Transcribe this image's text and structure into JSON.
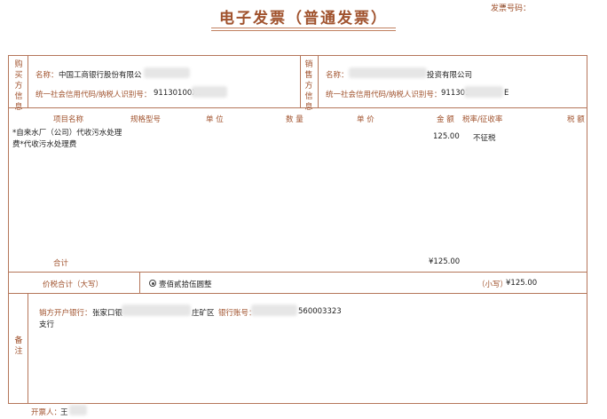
{
  "header": {
    "title": "电子发票（普通发票）",
    "invoice_no_label": "发票号码：",
    "invoice_no_value": "-"
  },
  "buyer": {
    "side_label": "购买方信息",
    "name_label": "名称：",
    "name_value": "中国工商银行股份有限公",
    "tax_label": "统一社会信用代码/纳税人识别号：",
    "tax_value": "91130100X0"
  },
  "seller": {
    "side_label": "销售方信息",
    "name_label": "名称：",
    "name_value": "投资有限公司",
    "tax_label": "统一社会信用代码/纳税人识别号：",
    "tax_value_prefix": "911301",
    "tax_value_suffix": "E"
  },
  "items_table": {
    "headers": [
      "项目名称",
      "规格型号",
      "单 位",
      "数 量",
      "单 价",
      "金 额",
      "税率/征收率",
      "税 额"
    ],
    "rows": [
      {
        "name_line1": "*自来水厂（公司）代收污水处理",
        "name_line2": "费*代收污水处理费",
        "amount": "125.00",
        "tax_rate": "不征税"
      }
    ],
    "subtotal_label": "合计",
    "subtotal_amount": "¥125.00"
  },
  "total": {
    "label": "价税合计（大写）",
    "uppercase_value": "壹佰贰拾伍圆整",
    "lowercase_label": "（小写）",
    "lowercase_value": "¥125.00"
  },
  "remarks": {
    "side_label": "备注",
    "bank_label": "销方开户银行：",
    "bank_value_prefix": "张家口银",
    "bank_value_suffix": "庄矿区",
    "bank_value_line2": "支行",
    "account_label": "银行账号：",
    "account_value": "560003323"
  },
  "footer": {
    "issuer_label": "开票人：",
    "issuer_value": "王"
  },
  "colors": {
    "accent": "#a0522d",
    "border": "#b5765a"
  }
}
